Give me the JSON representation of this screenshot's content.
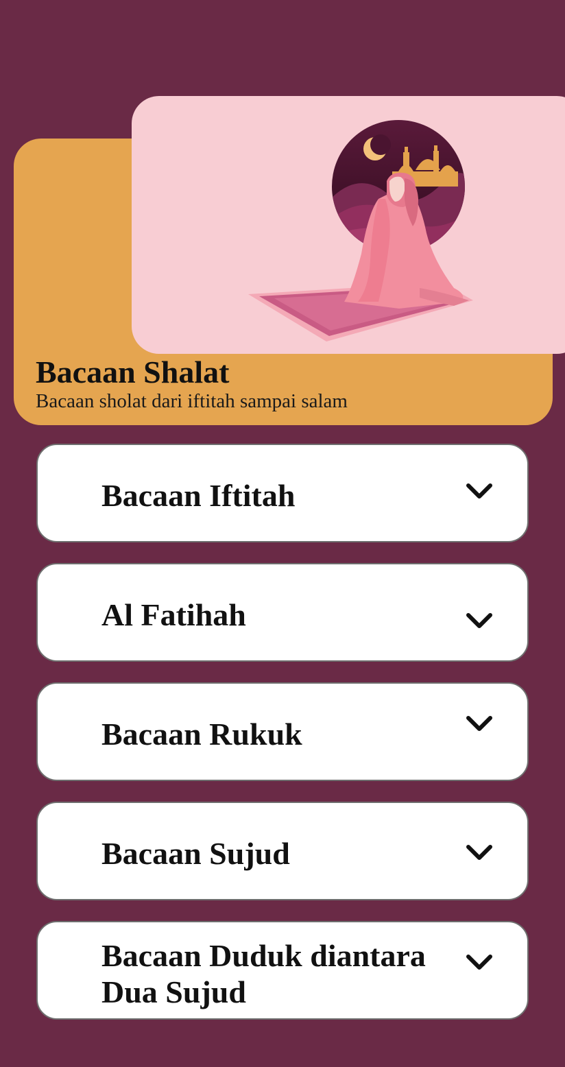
{
  "header": {
    "title": "Bacaan Shalat",
    "subtitle": "Bacaan sholat dari iftitah sampai salam"
  },
  "colors": {
    "background": "#6a2a46",
    "header_card": "#e5a550",
    "illustration_card": "#f8cdd3",
    "item_card": "#ffffff"
  },
  "illustration": {
    "name": "woman-praying-on-prayer-mat-with-mosque-and-crescent-moon"
  },
  "items": [
    {
      "label": "Bacaan Iftitah",
      "icon": "chevron-down-icon"
    },
    {
      "label": "Al Fatihah",
      "icon": "chevron-down-icon"
    },
    {
      "label": "Bacaan Rukuk",
      "icon": "chevron-down-icon"
    },
    {
      "label": "Bacaan Sujud",
      "icon": "chevron-down-icon"
    },
    {
      "label": "Bacaan Duduk diantara Dua Sujud",
      "icon": "chevron-down-icon"
    }
  ]
}
